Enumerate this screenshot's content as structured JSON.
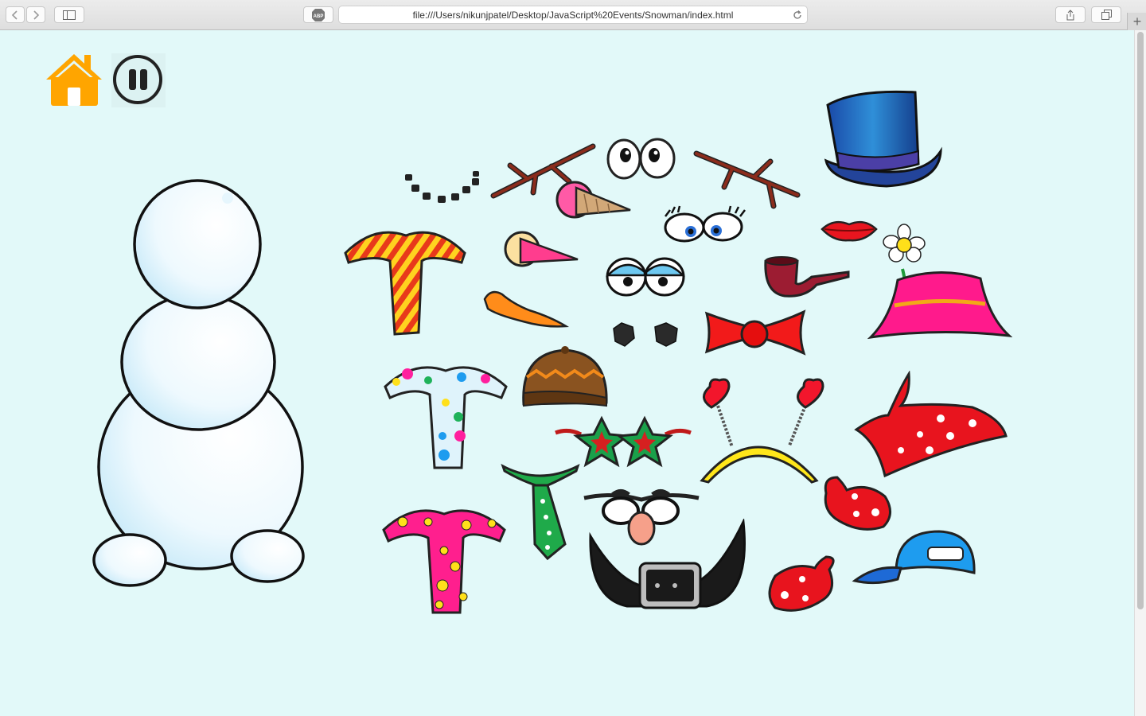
{
  "browser": {
    "url": "file:///Users/nikunjpatel/Desktop/JavaScript%20Events/Snowman/index.html",
    "adblock_label": "ABP",
    "new_tab_symbol": "+"
  },
  "controls": {
    "home_icon": "home-icon",
    "pause_icon": "pause-icon"
  },
  "colors": {
    "page_background": "#e2f9f9",
    "home_orange": "#ffa500",
    "snow_outline": "#111111"
  },
  "accessories": [
    "coal-mouth",
    "stick-arm-left",
    "big-eyes",
    "stick-arm-right",
    "top-hat",
    "ice-cream-nose",
    "lady-eyes",
    "red-lips",
    "striped-scarf",
    "pink-carrot-nose",
    "sleepy-eyes",
    "pipe",
    "flower-hat",
    "carrot-nose",
    "coal-eyes",
    "bow-tie",
    "polka-scarf",
    "brown-beanie",
    "star-glasses",
    "heart-headband",
    "red-bandana",
    "green-tie",
    "groucho-glasses",
    "belt",
    "red-mitten",
    "flower-scarf",
    "blue-cap"
  ]
}
